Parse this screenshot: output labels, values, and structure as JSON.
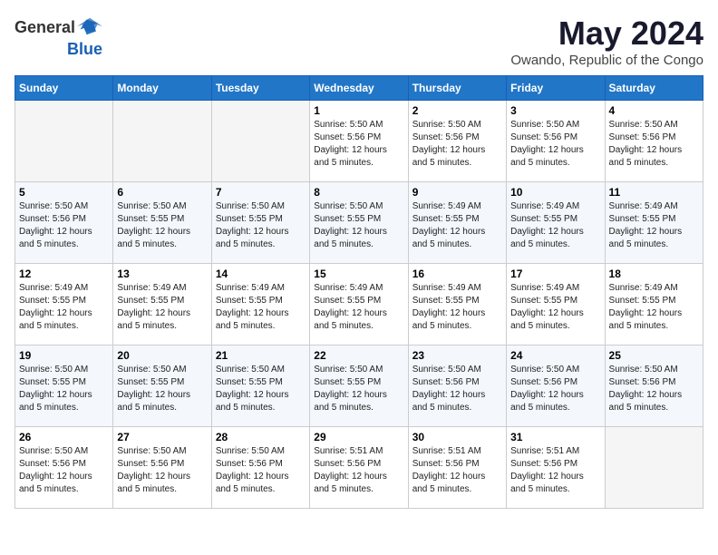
{
  "logo": {
    "text_general": "General",
    "text_blue": "Blue"
  },
  "title": {
    "month_year": "May 2024",
    "location": "Owando, Republic of the Congo"
  },
  "weekdays": [
    "Sunday",
    "Monday",
    "Tuesday",
    "Wednesday",
    "Thursday",
    "Friday",
    "Saturday"
  ],
  "weeks": [
    [
      {
        "day": "",
        "empty": true
      },
      {
        "day": "",
        "empty": true
      },
      {
        "day": "",
        "empty": true
      },
      {
        "day": "1",
        "sunrise": "5:50 AM",
        "sunset": "5:56 PM",
        "daylight": "12 hours and 5 minutes."
      },
      {
        "day": "2",
        "sunrise": "5:50 AM",
        "sunset": "5:56 PM",
        "daylight": "12 hours and 5 minutes."
      },
      {
        "day": "3",
        "sunrise": "5:50 AM",
        "sunset": "5:56 PM",
        "daylight": "12 hours and 5 minutes."
      },
      {
        "day": "4",
        "sunrise": "5:50 AM",
        "sunset": "5:56 PM",
        "daylight": "12 hours and 5 minutes."
      }
    ],
    [
      {
        "day": "5",
        "sunrise": "5:50 AM",
        "sunset": "5:56 PM",
        "daylight": "12 hours and 5 minutes."
      },
      {
        "day": "6",
        "sunrise": "5:50 AM",
        "sunset": "5:55 PM",
        "daylight": "12 hours and 5 minutes."
      },
      {
        "day": "7",
        "sunrise": "5:50 AM",
        "sunset": "5:55 PM",
        "daylight": "12 hours and 5 minutes."
      },
      {
        "day": "8",
        "sunrise": "5:50 AM",
        "sunset": "5:55 PM",
        "daylight": "12 hours and 5 minutes."
      },
      {
        "day": "9",
        "sunrise": "5:49 AM",
        "sunset": "5:55 PM",
        "daylight": "12 hours and 5 minutes."
      },
      {
        "day": "10",
        "sunrise": "5:49 AM",
        "sunset": "5:55 PM",
        "daylight": "12 hours and 5 minutes."
      },
      {
        "day": "11",
        "sunrise": "5:49 AM",
        "sunset": "5:55 PM",
        "daylight": "12 hours and 5 minutes."
      }
    ],
    [
      {
        "day": "12",
        "sunrise": "5:49 AM",
        "sunset": "5:55 PM",
        "daylight": "12 hours and 5 minutes."
      },
      {
        "day": "13",
        "sunrise": "5:49 AM",
        "sunset": "5:55 PM",
        "daylight": "12 hours and 5 minutes."
      },
      {
        "day": "14",
        "sunrise": "5:49 AM",
        "sunset": "5:55 PM",
        "daylight": "12 hours and 5 minutes."
      },
      {
        "day": "15",
        "sunrise": "5:49 AM",
        "sunset": "5:55 PM",
        "daylight": "12 hours and 5 minutes."
      },
      {
        "day": "16",
        "sunrise": "5:49 AM",
        "sunset": "5:55 PM",
        "daylight": "12 hours and 5 minutes."
      },
      {
        "day": "17",
        "sunrise": "5:49 AM",
        "sunset": "5:55 PM",
        "daylight": "12 hours and 5 minutes."
      },
      {
        "day": "18",
        "sunrise": "5:49 AM",
        "sunset": "5:55 PM",
        "daylight": "12 hours and 5 minutes."
      }
    ],
    [
      {
        "day": "19",
        "sunrise": "5:50 AM",
        "sunset": "5:55 PM",
        "daylight": "12 hours and 5 minutes."
      },
      {
        "day": "20",
        "sunrise": "5:50 AM",
        "sunset": "5:55 PM",
        "daylight": "12 hours and 5 minutes."
      },
      {
        "day": "21",
        "sunrise": "5:50 AM",
        "sunset": "5:55 PM",
        "daylight": "12 hours and 5 minutes."
      },
      {
        "day": "22",
        "sunrise": "5:50 AM",
        "sunset": "5:55 PM",
        "daylight": "12 hours and 5 minutes."
      },
      {
        "day": "23",
        "sunrise": "5:50 AM",
        "sunset": "5:56 PM",
        "daylight": "12 hours and 5 minutes."
      },
      {
        "day": "24",
        "sunrise": "5:50 AM",
        "sunset": "5:56 PM",
        "daylight": "12 hours and 5 minutes."
      },
      {
        "day": "25",
        "sunrise": "5:50 AM",
        "sunset": "5:56 PM",
        "daylight": "12 hours and 5 minutes."
      }
    ],
    [
      {
        "day": "26",
        "sunrise": "5:50 AM",
        "sunset": "5:56 PM",
        "daylight": "12 hours and 5 minutes."
      },
      {
        "day": "27",
        "sunrise": "5:50 AM",
        "sunset": "5:56 PM",
        "daylight": "12 hours and 5 minutes."
      },
      {
        "day": "28",
        "sunrise": "5:50 AM",
        "sunset": "5:56 PM",
        "daylight": "12 hours and 5 minutes."
      },
      {
        "day": "29",
        "sunrise": "5:51 AM",
        "sunset": "5:56 PM",
        "daylight": "12 hours and 5 minutes."
      },
      {
        "day": "30",
        "sunrise": "5:51 AM",
        "sunset": "5:56 PM",
        "daylight": "12 hours and 5 minutes."
      },
      {
        "day": "31",
        "sunrise": "5:51 AM",
        "sunset": "5:56 PM",
        "daylight": "12 hours and 5 minutes."
      },
      {
        "day": "",
        "empty": true
      }
    ]
  ],
  "labels": {
    "sunrise": "Sunrise:",
    "sunset": "Sunset:",
    "daylight": "Daylight:"
  }
}
